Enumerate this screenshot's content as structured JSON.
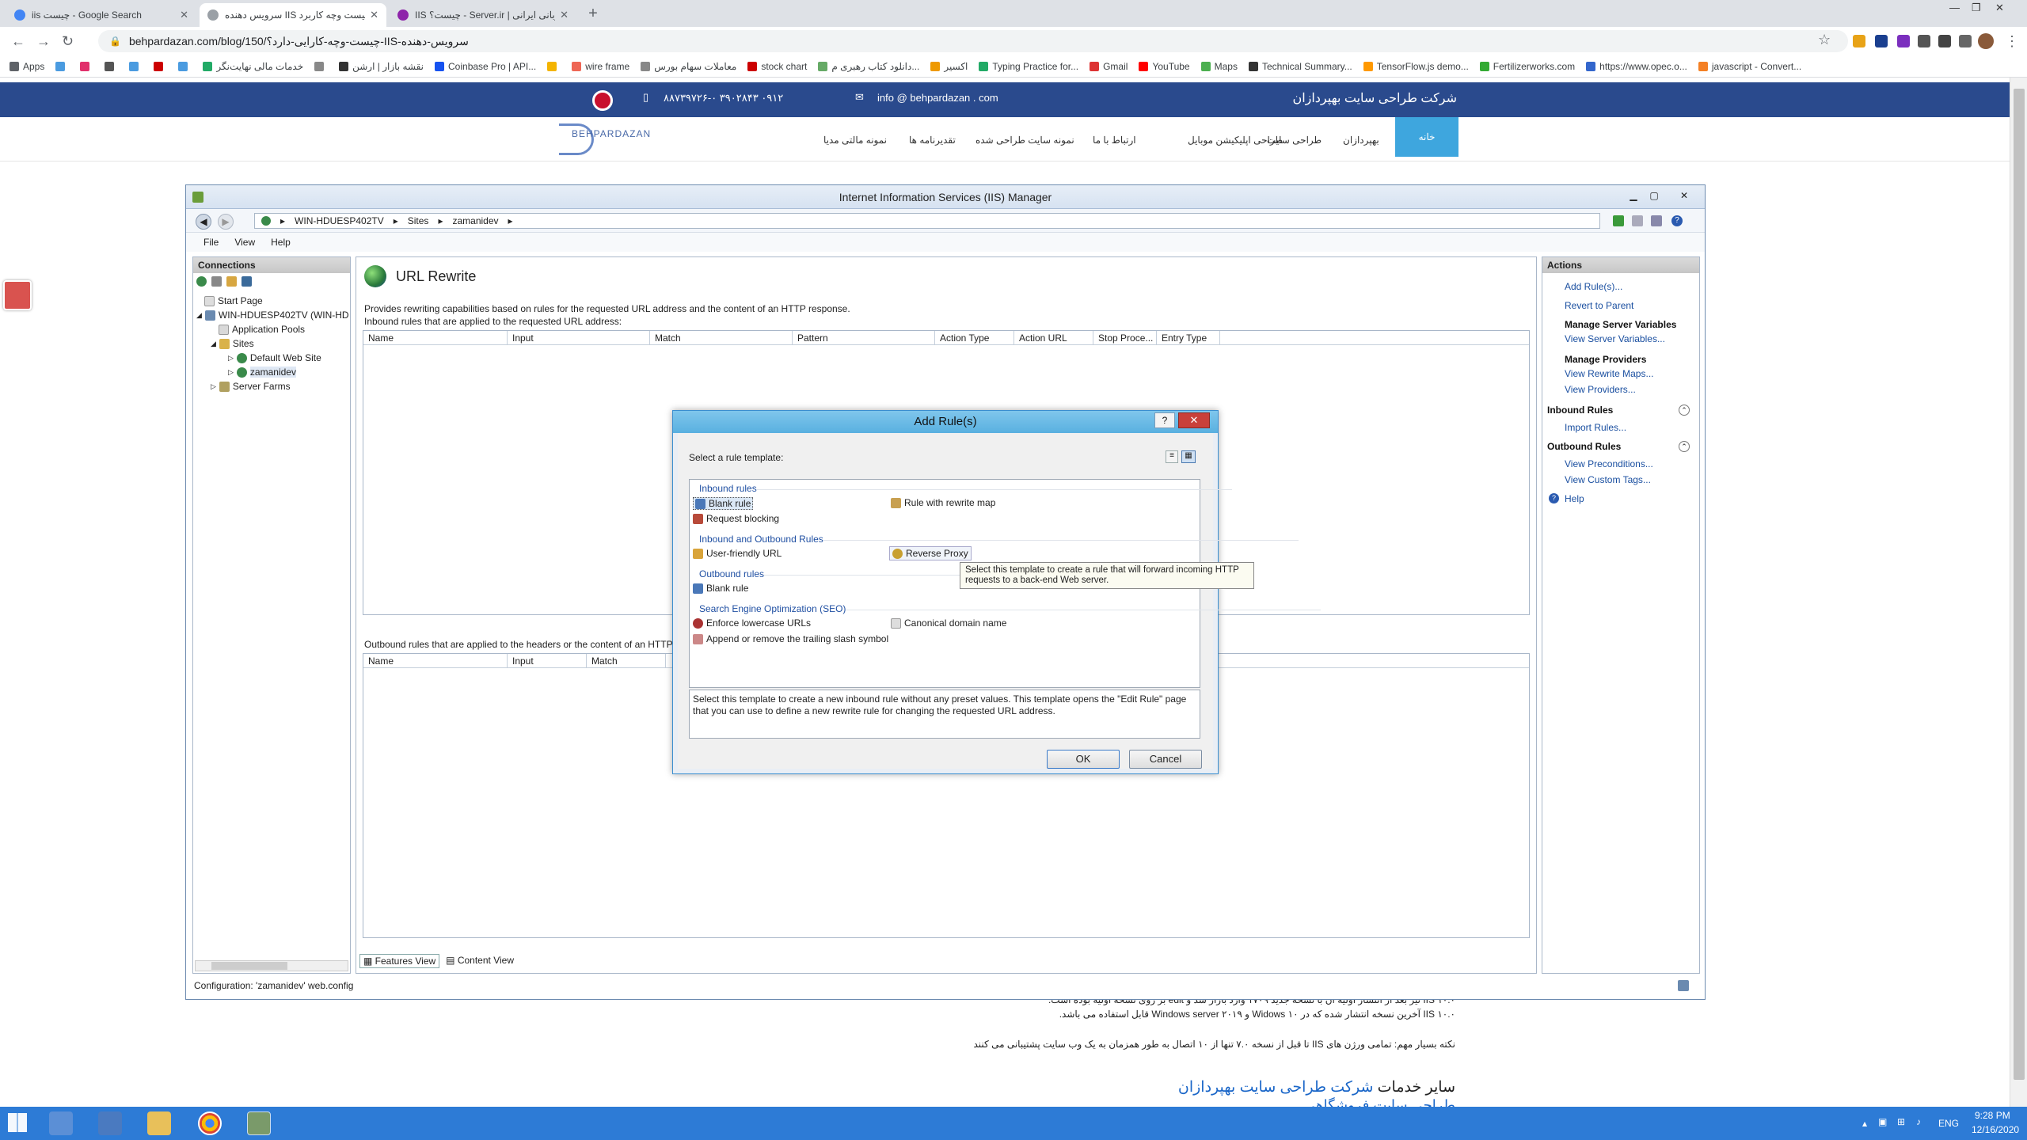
{
  "browser": {
    "tabs": [
      {
        "title": "iis چیست - Google Search",
        "fav_color": "#4285f4"
      },
      {
        "title": "سرویس دهنده IIS چیست وچه کاربرد...",
        "fav_color": "#9aa0a6"
      },
      {
        "title": "IIS چیست؟ - Server.ir | میزبانی ایرانی",
        "fav_color": "#8e24aa"
      }
    ],
    "url": "behpardazan.com/blog/150/چیست-وچه-کارایی-دارد؟-IIS-سرویس-دهنده"
  },
  "bookmarks": [
    {
      "label": "Apps",
      "color": "#5f6368"
    },
    {
      "label": "",
      "color": "#4a9be0"
    },
    {
      "label": "",
      "color": "#e1306c"
    },
    {
      "label": "",
      "color": "#555"
    },
    {
      "label": "",
      "color": "#4a9be0"
    },
    {
      "label": "",
      "color": "#c00"
    },
    {
      "label": "",
      "color": "#4a9be0"
    },
    {
      "label": "خدمات مالی نهایت‌نگر",
      "color": "#2a6"
    },
    {
      "label": "",
      "color": "#888"
    },
    {
      "label": "نقشه بازار | ارشن",
      "color": "#333"
    },
    {
      "label": "Coinbase Pro | API...",
      "color": "#1652f0"
    },
    {
      "label": "",
      "color": "#f4b400"
    },
    {
      "label": "wire frame",
      "color": "#e65"
    },
    {
      "label": "معاملات سهام بورس",
      "color": "#888"
    },
    {
      "label": "stock chart",
      "color": "#c00"
    },
    {
      "label": "دانلود کتاب رهبری م...",
      "color": "#6a6"
    },
    {
      "label": "اکسیر",
      "color": "#e90"
    },
    {
      "label": "Typing Practice for...",
      "color": "#2a6"
    },
    {
      "label": "Gmail",
      "color": "#d33"
    },
    {
      "label": "YouTube",
      "color": "#f00"
    },
    {
      "label": "Maps",
      "color": "#4caf50"
    },
    {
      "label": "Technical Summary...",
      "color": "#333"
    },
    {
      "label": "TensorFlow.js demo...",
      "color": "#f90"
    },
    {
      "label": "Fertilizerworks.com",
      "color": "#3a3"
    },
    {
      "label": "https://www.opec.o...",
      "color": "#36c"
    },
    {
      "label": "javascript - Convert...",
      "color": "#f48024"
    }
  ],
  "site": {
    "company": "شرکت طراحی سایت بهپردازان",
    "phone": "۰۹۱۲ ۳۹۰۲۸۴۳ ۸۸۷۳۹۷۲۶-۰",
    "email": "info @ behpardazan . com",
    "logo": "BEHPARDAZAN",
    "menu": [
      "خانه",
      "بهپردازان",
      "طراحی سایت",
      "طراحی اپلیکیشن موبایل",
      "ارتباط با ما",
      "نمونه سایت طراحی شده",
      "تقدیرنامه ها",
      "نمونه مالتی مدیا"
    ]
  },
  "iis": {
    "title": "Internet Information Services (IIS) Manager",
    "crumbs": [
      "WIN-HDUESP402TV",
      "Sites",
      "zamanidev"
    ],
    "menu": [
      "File",
      "View",
      "Help"
    ],
    "connections": {
      "header": "Connections",
      "tree": [
        "Start Page",
        "WIN-HDUESP402TV (WIN-HD",
        "Application Pools",
        "Sites",
        "Default Web Site",
        "zamanidev",
        "Server Farms"
      ]
    },
    "feature": {
      "title": "URL Rewrite",
      "description": "Provides rewriting capabilities based on rules for the requested URL address and the content of an HTTP response.",
      "inbound_label": "Inbound rules that are applied to the requested URL address:",
      "inbound_columns": [
        "Name",
        "Input",
        "Match",
        "Pattern",
        "Action Type",
        "Action URL",
        "Stop Proce...",
        "Entry Type"
      ],
      "outbound_label": "Outbound rules that are applied to the headers or the content of an HTTP",
      "outbound_columns": [
        "Name",
        "Input",
        "Match"
      ]
    },
    "view_tabs": [
      "Features View",
      "Content View"
    ],
    "status": "Configuration: 'zamanidev' web.config",
    "actions": {
      "header": "Actions",
      "add_rules": "Add Rule(s)...",
      "revert": "Revert to Parent",
      "server_vars_head": "Manage Server Variables",
      "server_vars": "View Server Variables...",
      "providers_head": "Manage Providers",
      "rewrite_maps": "View Rewrite Maps...",
      "providers": "View Providers...",
      "inbound_head": "Inbound Rules",
      "import": "Import Rules...",
      "outbound_head": "Outbound Rules",
      "preconditions": "View Preconditions...",
      "custom_tags": "View Custom Tags...",
      "help": "Help"
    }
  },
  "dialog": {
    "title": "Add Rule(s)",
    "prompt": "Select a rule template:",
    "groups": {
      "inbound": "Inbound rules",
      "inout": "Inbound and Outbound Rules",
      "outbound": "Outbound rules",
      "seo": "Search Engine Optimization (SEO)"
    },
    "items": {
      "blank_in": "Blank rule",
      "rewrite_map": "Rule with rewrite map",
      "request_blocking": "Request blocking",
      "friendly_url": "User-friendly URL",
      "reverse_proxy": "Reverse Proxy",
      "blank_out": "Blank rule",
      "lowercase": "Enforce lowercase URLs",
      "canonical": "Canonical domain name",
      "trailing_slash": "Append or remove the trailing slash symbol"
    },
    "description": "Select this template to create a new inbound rule without any preset values. This template opens the \"Edit Rule\" page that you can use to define a new rewrite rule for changing the requested URL address.",
    "ok": "OK",
    "cancel": "Cancel",
    "tooltip": "Select this template to create a rule that will forward incoming HTTP requests to a back-end Web server."
  },
  "article": {
    "line1": "IIS ۱۰.۰ نیز بعد از انتشار اولیه آن با نسخه جدید ۱۷۰۹ وارد بازار شد و edit بر روی نسخه اولیه بوده است.",
    "line2": "IIS ۱۰.۰ آخرین نسخه  انتشار شده که در Widows ۱۰ و Windows server ۲۰۱۹ قابل استفاده می باشد.",
    "line3": "نکته بسیار مهم: تمامی ورژن های IIS تا قبل از نسخه ۷.۰ تنها از ۱۰ اتصال به طور همزمان به یک وب سایت پشتیبانی می کنند",
    "services_prefix": "سایر خدمات",
    "services_link": "شرکت طراحی سایت بهپردازان",
    "sub_link": "طراحی سایت فروشگاهی"
  },
  "taskbar": {
    "time": "9:28 PM",
    "date": "12/16/2020",
    "lang": "ENG"
  }
}
